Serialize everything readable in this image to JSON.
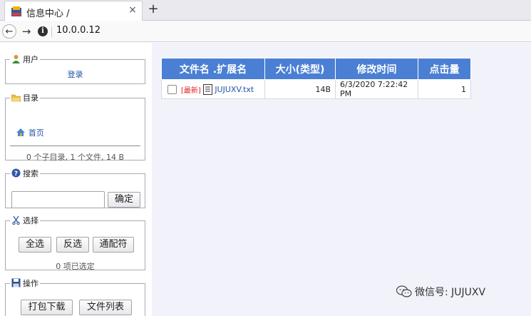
{
  "browser": {
    "tab_title": "信息中心 /",
    "close_glyph": "×",
    "new_tab_glyph": "+",
    "back_glyph": "←",
    "forward_glyph": "→",
    "info_glyph": "i",
    "url": "10.0.0.12"
  },
  "sidebar": {
    "user": {
      "legend": "用户",
      "login_link": "登录"
    },
    "directory": {
      "legend": "目录",
      "home_link": "首页",
      "summary": "0 个子目录, 1 个文件, 14 B"
    },
    "search": {
      "legend": "搜索",
      "input_value": "",
      "confirm_label": "确定"
    },
    "select": {
      "legend": "选择",
      "select_all": "全选",
      "invert": "反选",
      "wildcard": "通配符",
      "selected_count": "0 项已选定"
    },
    "operations": {
      "legend": "操作",
      "pack_download": "打包下载",
      "file_list": "文件列表"
    }
  },
  "table": {
    "headers": [
      "文件名 .扩展名",
      "大小(类型)",
      "修改时间",
      "点击量"
    ],
    "rows": [
      {
        "badge": "[最新]",
        "name": "JUJUXV.txt",
        "size": "14B",
        "modified": "6/3/2020 7:22:42 PM",
        "hits": "1"
      }
    ]
  },
  "watermark": {
    "text": "微信号: JUJUXV"
  },
  "colors": {
    "header_bg": "#4a7fd4",
    "link": "#2255aa",
    "new_badge": "#dd2222",
    "page_bg": "#f2f2fb"
  },
  "icons": [
    "favicon-icon",
    "info-icon",
    "user-icon",
    "folder-icon",
    "help-icon",
    "scissors-icon",
    "save-icon",
    "home-icon",
    "file-icon",
    "wechat-icon"
  ]
}
